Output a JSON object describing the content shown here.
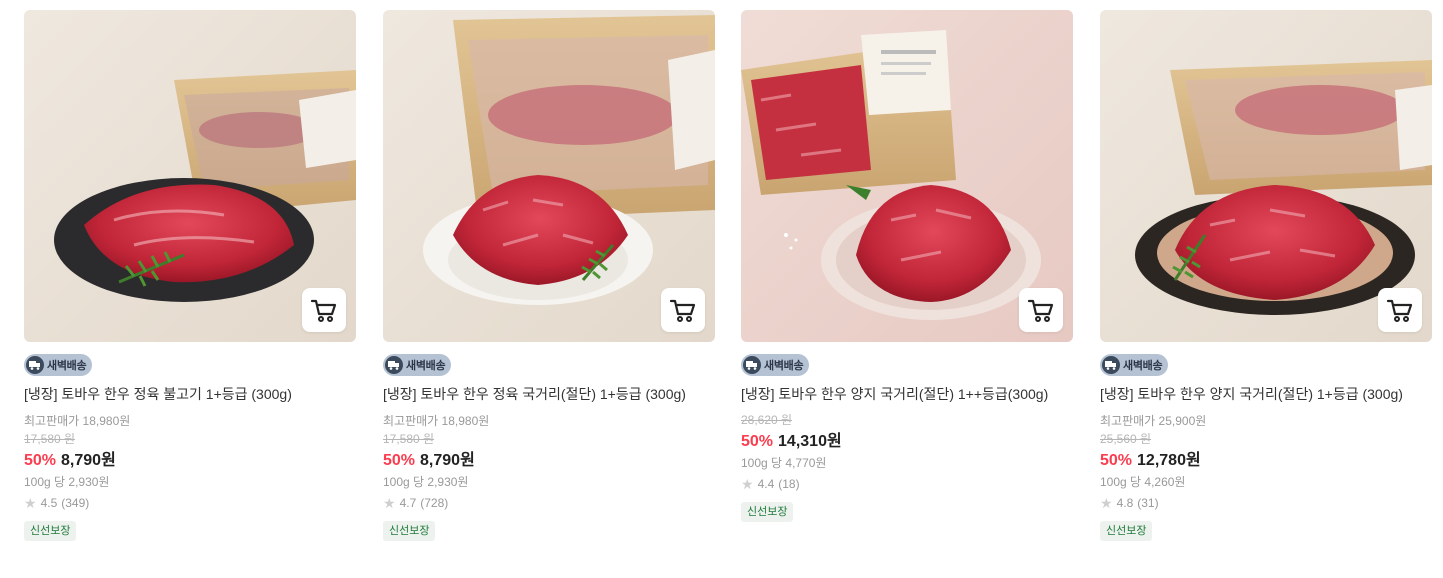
{
  "colors": {
    "discount": "#fa3d4f",
    "badge_bg": "#b4c2d3",
    "fresh_text": "#1f7a3a",
    "fresh_bg": "#eef2ef"
  },
  "products": [
    {
      "photo_icon": "beef-bulgogi-photo",
      "badge": "새벽배송",
      "title": "[냉장] 토바우 한우 정육 불고기 1+등급 (300g)",
      "best_price": "최고판매가 18,980원",
      "original_price": "17,580 원",
      "discount": "50%",
      "price": "8,790원",
      "unit_price": "100g 당 2,930원",
      "rating": "4.5",
      "reviews": "(349)",
      "tag": "신선보장"
    },
    {
      "photo_icon": "beef-cubes-photo",
      "badge": "새벽배송",
      "title": "[냉장] 토바우 한우 정육 국거리(절단) 1+등급 (300g)",
      "best_price": "최고판매가 18,980원",
      "original_price": "17,580 원",
      "discount": "50%",
      "price": "8,790원",
      "unit_price": "100g 당 2,930원",
      "rating": "4.7",
      "reviews": "(728)",
      "tag": "신선보장"
    },
    {
      "photo_icon": "beef-brisket-cubes-photo",
      "badge": "새벽배송",
      "title": "[냉장] 토바우 한우 양지 국거리(절단) 1++등급(300g)",
      "original_price": "28,620 원",
      "discount": "50%",
      "price": "14,310원",
      "unit_price": "100g 당 4,770원",
      "rating": "4.4",
      "reviews": "(18)",
      "tag": "신선보장"
    },
    {
      "photo_icon": "beef-brisket-bowl-photo",
      "badge": "새벽배송",
      "title": "[냉장] 토바우 한우 양지 국거리(절단) 1+등급 (300g)",
      "best_price": "최고판매가 25,900원",
      "original_price": "25,560 원",
      "discount": "50%",
      "price": "12,780원",
      "unit_price": "100g 당 4,260원",
      "rating": "4.8",
      "reviews": "(31)",
      "tag": "신선보장"
    }
  ]
}
